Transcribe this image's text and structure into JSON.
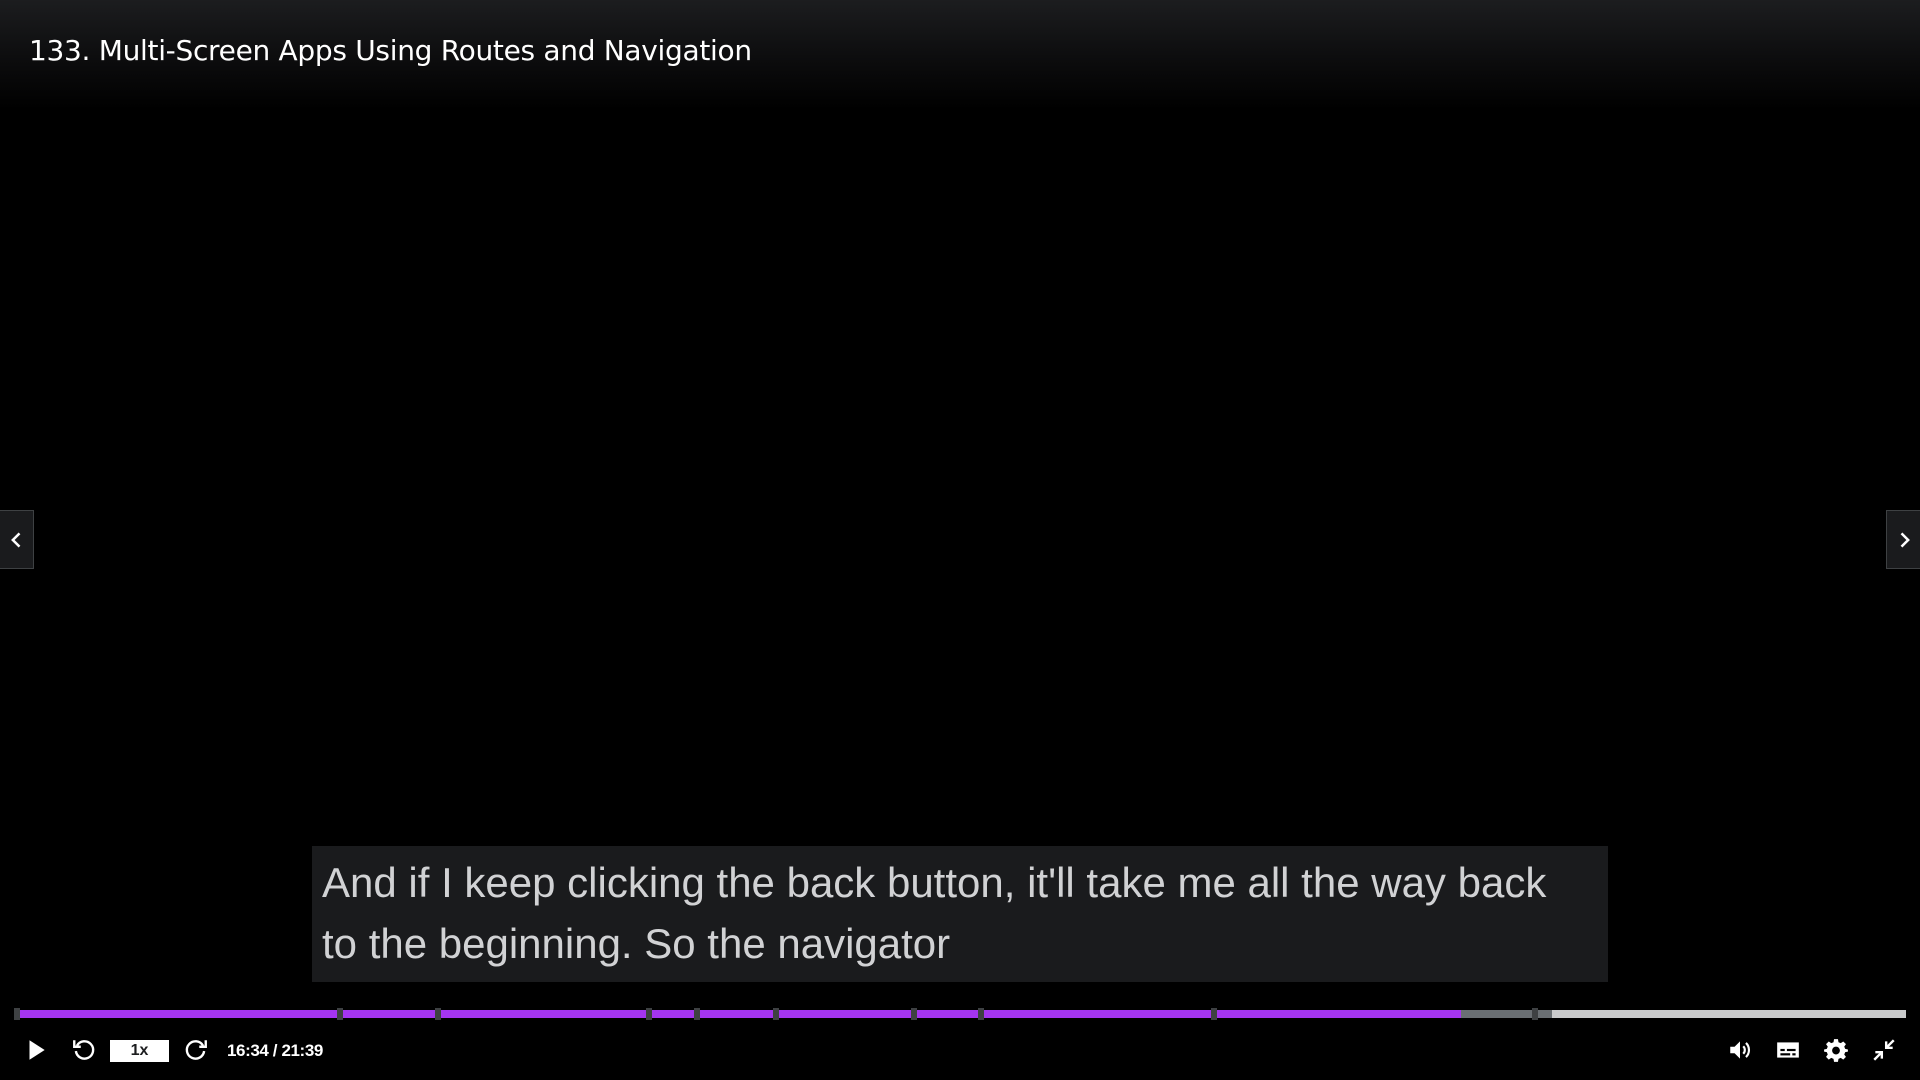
{
  "lecture": {
    "title": "133. Multi-Screen Apps Using Routes and Navigation"
  },
  "captions": {
    "line1": "And if I keep clicking the back button, it'll take me all the way back",
    "line2": "to the beginning. So the navigator"
  },
  "playback": {
    "current_time": "16:34",
    "duration": "21:39",
    "time_display": "16:34 / 21:39",
    "rate_label": "1x",
    "progress_fraction": 0.765,
    "buffered_fraction": 0.813,
    "chapter_markers": [
      "00:00",
      "03:42",
      "04:49",
      "07:14",
      "07:47",
      "08:41",
      "10:16",
      "11:02",
      "13:42",
      "17:22"
    ]
  },
  "icons": {
    "play": "play-icon",
    "rewind": "rewind-5s-icon",
    "forward": "forward-5s-icon",
    "volume": "volume-icon",
    "captions": "captions-icon",
    "settings": "gear-icon",
    "exit_fullscreen": "exit-fullscreen-icon",
    "prev": "chevron-left-icon",
    "next": "chevron-right-icon"
  },
  "colors": {
    "progress_played": "#a435f0",
    "progress_buffered": "#6a6f73",
    "progress_track": "#c9cacb",
    "caption_background": "#1c1d1f",
    "caption_text": "#d1d2d4"
  }
}
